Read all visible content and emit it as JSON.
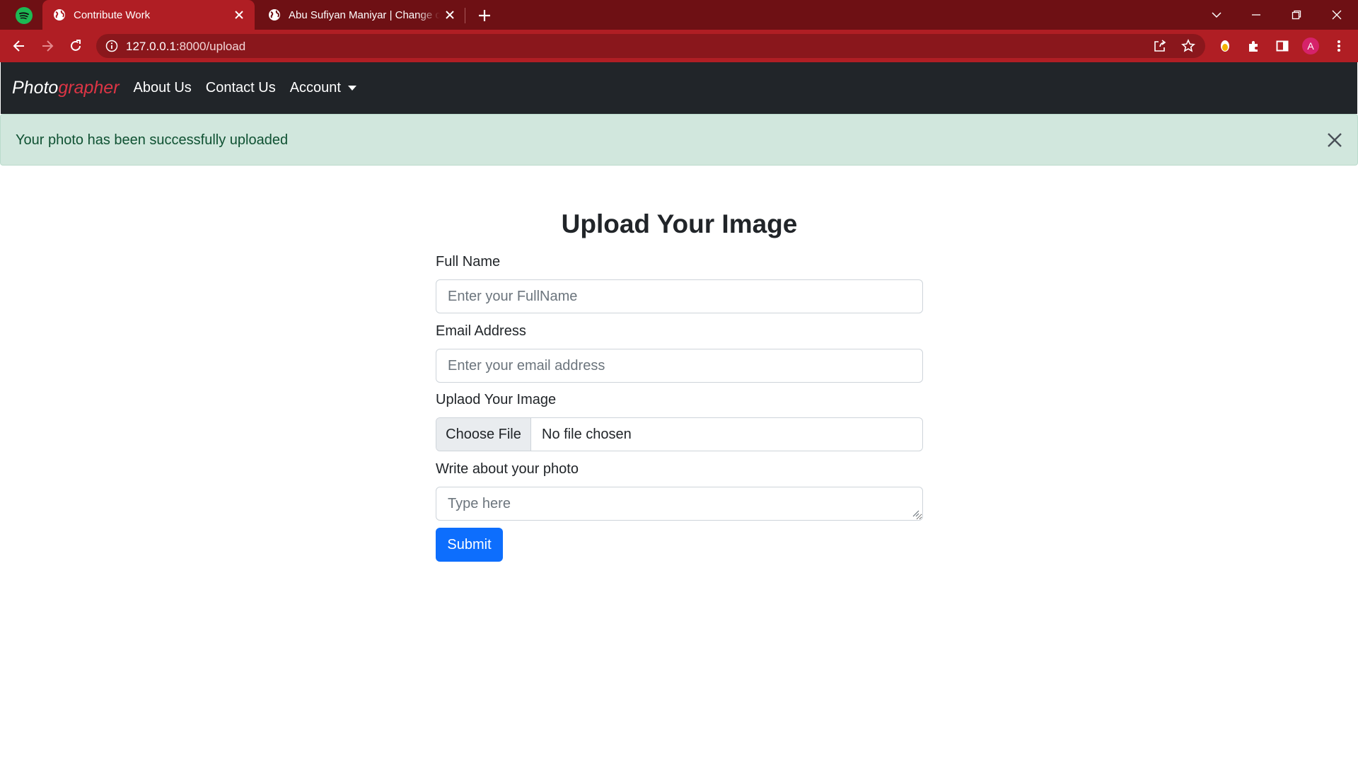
{
  "browser": {
    "tabs": [
      {
        "title": "Contribute Work",
        "active": true
      },
      {
        "title": "Abu Sufiyan Maniyar | Change color",
        "active": false
      }
    ],
    "url_host": "127.0.0.1",
    "url_path": ":8000/upload",
    "profile_initial": "A",
    "colors": {
      "tabstrip": "#6e1014",
      "toolbar": "#b01e24"
    }
  },
  "navbar": {
    "brand_main": "Photo",
    "brand_accent": "grapher",
    "links": [
      "About Us",
      "Contact Us",
      "Account"
    ]
  },
  "alert": {
    "message": "Your photo has been successfully uploaded",
    "type": "success"
  },
  "form": {
    "title": "Upload Your Image",
    "full_name": {
      "label": "Full Name",
      "placeholder": "Enter your FullName",
      "value": ""
    },
    "email": {
      "label": "Email Address",
      "placeholder": "Enter your email address",
      "value": ""
    },
    "image": {
      "label": "Uplaod Your Image",
      "button": "Choose File",
      "status": "No file chosen"
    },
    "about": {
      "label": "Write about your photo",
      "placeholder": "Type here",
      "value": ""
    },
    "submit_label": "Submit"
  },
  "colors": {
    "navbar_bg": "#212529",
    "brand_accent": "#dc3545",
    "alert_bg": "#d1e7dd",
    "alert_text": "#0f5132",
    "primary": "#0d6efd"
  }
}
